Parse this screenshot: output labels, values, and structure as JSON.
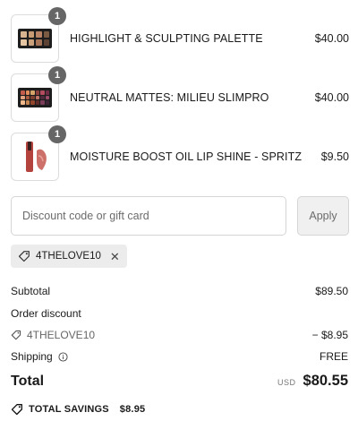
{
  "cart": {
    "items": [
      {
        "name": "HIGHLIGHT & SCULPTING PALETTE",
        "price": "$40.00",
        "quantity": "1",
        "thumb_icon": "highlight-sculpting-palette",
        "swatches": [
          "#d7b38f",
          "#c99b73",
          "#b98466",
          "#7b5a42",
          "#e7c6a4",
          "#caa17a",
          "#a77457",
          "#5e4233"
        ]
      },
      {
        "name": "NEUTRAL MATTES: MILIEU SLIMPRO",
        "price": "$40.00",
        "quantity": "1",
        "thumb_icon": "eyeshadow-palette",
        "swatches": [
          "#c25b4b",
          "#e18a5a",
          "#d5a468",
          "#8a3e3b",
          "#b24b5e",
          "#6e2b45",
          "#e3a27e",
          "#a8593d",
          "#7c3f2f",
          "#c07566",
          "#4c2a3b",
          "#9a4a6a",
          "#f0b98b",
          "#c58350",
          "#93452e",
          "#5e2b2a",
          "#7a3c59",
          "#3b2235"
        ]
      },
      {
        "name": "MOISTURE BOOST OIL LIP SHINE - SPRITZ",
        "price": "$9.50",
        "quantity": "1",
        "thumb_icon": "lip-gloss",
        "color": "#b4423d"
      }
    ]
  },
  "discount": {
    "placeholder": "Discount code or gift card",
    "apply_label": "Apply",
    "applied_code": "4THELOVE10"
  },
  "summary": {
    "subtotal_label": "Subtotal",
    "subtotal_value": "$89.50",
    "order_discount_label": "Order discount",
    "discount_code": "4THELOVE10",
    "discount_value": "− $8.95",
    "shipping_label": "Shipping",
    "shipping_value": "FREE",
    "total_label": "Total",
    "currency": "USD",
    "total_value": "$80.55",
    "savings_label": "TOTAL SAVINGS",
    "savings_value": "$8.95"
  }
}
